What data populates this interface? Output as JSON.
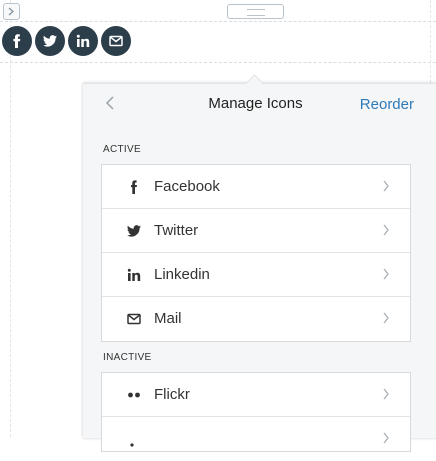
{
  "canvas": {
    "corner_icon": "expand-icon",
    "top_pill_icon": "menu-lines-icon"
  },
  "social_bar": {
    "icons": [
      "facebook-icon",
      "twitter-icon",
      "linkedin-icon",
      "mail-icon"
    ],
    "color": "#2d3e4b"
  },
  "popover": {
    "title": "Manage Icons",
    "back_icon": "chevron-left-icon",
    "reorder_label": "Reorder",
    "accent_color": "#2e7ab8",
    "active_label": "ACTIVE",
    "active_items": [
      {
        "label": "Facebook",
        "icon": "facebook-icon"
      },
      {
        "label": "Twitter",
        "icon": "twitter-icon"
      },
      {
        "label": "Linkedin",
        "icon": "linkedin-icon"
      },
      {
        "label": "Mail",
        "icon": "mail-icon"
      }
    ],
    "inactive_label": "INACTIVE",
    "inactive_items": [
      {
        "label": "Flickr",
        "icon": "flickr-icon"
      },
      {
        "label": "",
        "icon": "unknown-icon"
      }
    ]
  }
}
